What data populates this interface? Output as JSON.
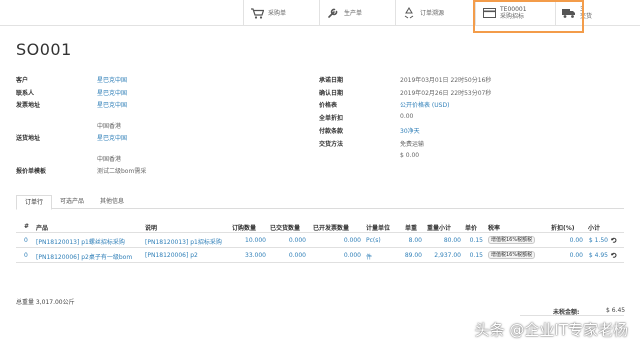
{
  "smart_buttons": [
    {
      "label": "采购单",
      "value": "",
      "icon": "cart-icon"
    },
    {
      "label": "生产单",
      "value": "",
      "icon": "wrench-icon"
    },
    {
      "label": "订单溯源",
      "value": "",
      "icon": "recycle-icon"
    },
    {
      "label": "采购招标",
      "value": "TE00001",
      "icon": "card-icon"
    },
    {
      "label": "交货",
      "value": "3",
      "icon": "truck-icon"
    }
  ],
  "record_title": "SO001",
  "left_fields": {
    "customer_label": "客户",
    "customer": "星巴克中国",
    "contact_label": "联系人",
    "contact": "星巴克中国",
    "invoice_addr_label": "发票地址",
    "invoice_addr": "星巴克中国",
    "invoice_country": "中国香港",
    "ship_addr_label": "送货地址",
    "ship_addr": "星巴克中国",
    "ship_country": "中国香港",
    "quote_tpl_label": "报价单模板",
    "quote_tpl": "测试二级bom需采"
  },
  "right_fields": {
    "promise_date_label": "承诺日期",
    "promise_date": "2019年03月01日 22时50分16秒",
    "confirm_date_label": "确认日期",
    "confirm_date": "2019年02月26日 22时53分07秒",
    "pricelist_label": "价格表",
    "pricelist": "公开价格表 (USD)",
    "discount_label": "全单折扣",
    "discount": "0.00",
    "payment_label": "付款条款",
    "payment": "30净天",
    "delivery_label": "交货方法",
    "delivery": "免费运输",
    "delivery_cost": "$ 0.00"
  },
  "tabs": [
    "订单行",
    "可选产品",
    "其他信息"
  ],
  "table": {
    "headers": [
      "#",
      "产品",
      "说明",
      "订购数量",
      "已交货数量",
      "已开发票数量",
      "计量单位",
      "单重",
      "重量小计",
      "单价",
      "税率",
      "折扣(%)",
      "小计"
    ],
    "rows": [
      {
        "seq": "0",
        "product": "[PN18120013] p1螺丝招标采购",
        "desc": "[PN18120013] p1招标采购",
        "qty": "10.000",
        "delivered": "0.000",
        "invoiced": "0.000",
        "uom": "Pc(s)",
        "unit_weight": "8.00",
        "weight_subtotal": "80.00",
        "price": "0.15",
        "tax": "增值税16%税额税",
        "discount": "0.00",
        "subtotal": "$ 1.50"
      },
      {
        "seq": "0",
        "product": "[PN18120006] p2桌子有一级bom",
        "desc": "[PN18120006] p2",
        "qty": "33.000",
        "delivered": "0.000",
        "invoiced": "0.000",
        "uom": "件",
        "unit_weight": "89.00",
        "weight_subtotal": "2,937.00",
        "price": "0.15",
        "tax": "增值税16%税额税",
        "discount": "0.00",
        "subtotal": "$ 4.95"
      }
    ]
  },
  "footer": {
    "total_weight": "总重量 3,017.00公斤",
    "untaxed_label": "未税金额:",
    "untaxed_value": "$ 6.45"
  },
  "watermark": "头条 @企业IT专家老杨",
  "colors": {
    "link": "#2f7fb8",
    "highlight_box": "#f39c4a"
  }
}
